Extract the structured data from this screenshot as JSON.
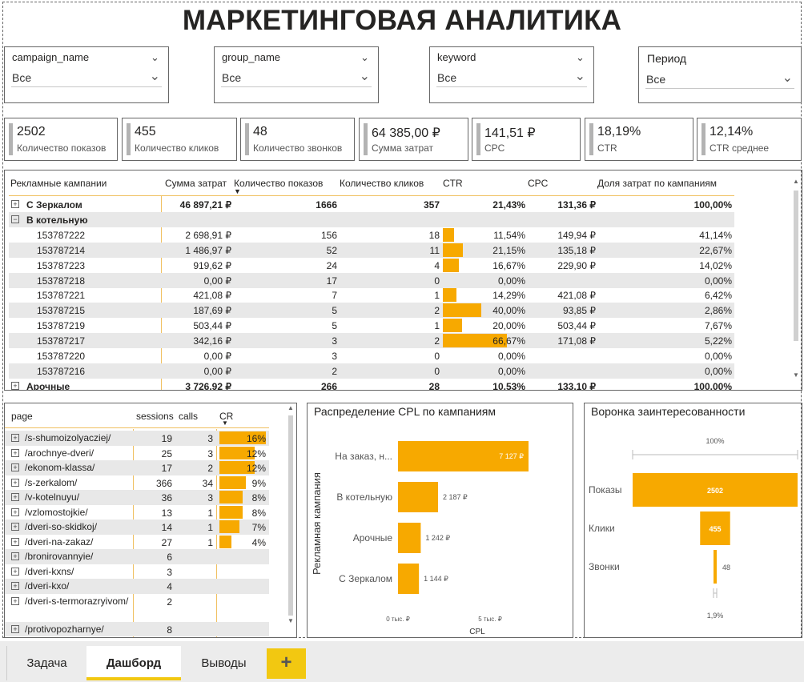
{
  "title": "МАРКЕТИНГОВАЯ АНАЛИТИКА",
  "slicers": [
    {
      "label": "campaign_name",
      "value": "Все"
    },
    {
      "label": "group_name",
      "value": "Все"
    },
    {
      "label": "keyword",
      "value": "Все"
    },
    {
      "label": "Период",
      "value": "Все"
    }
  ],
  "kpis": [
    {
      "value": "2502",
      "caption": "Количество показов"
    },
    {
      "value": "455",
      "caption": "Количество кликов"
    },
    {
      "value": "48",
      "caption": "Количество звонков"
    },
    {
      "value": "64 385,00 ₽",
      "caption": "Сумма затрат"
    },
    {
      "value": "141,51 ₽",
      "caption": "CPC"
    },
    {
      "value": "18,19%",
      "caption": "CTR"
    },
    {
      "value": "12,14%",
      "caption": "CTR среднее"
    }
  ],
  "matrix": {
    "headers": [
      "Рекламные кампании",
      "Сумма затрат",
      "Количество показов",
      "Количество кликов",
      "CTR",
      "CPC",
      "Доля затрат по кампаниям"
    ],
    "rows": [
      {
        "type": "group",
        "expand": "+",
        "name": "С Зеркалом",
        "cost": "46 897,21 ₽",
        "shows": "1666",
        "clicks": "357",
        "ctr": "21,43%",
        "ctr_value": 0,
        "cpc": "131,36 ₽",
        "share": "100,00%"
      },
      {
        "type": "group-open",
        "expand": "−",
        "name": "В котельную",
        "cost": "",
        "shows": "",
        "clicks": "",
        "ctr": "",
        "ctr_value": 0,
        "cpc": "",
        "share": ""
      },
      {
        "type": "item",
        "name": "153787222",
        "cost": "2 698,91 ₽",
        "shows": "156",
        "clicks": "18",
        "ctr": "11,54%",
        "ctr_value": 11.54,
        "cpc": "149,94 ₽",
        "share": "41,14%"
      },
      {
        "type": "item",
        "name": "153787214",
        "cost": "1 486,97 ₽",
        "shows": "52",
        "clicks": "11",
        "ctr": "21,15%",
        "ctr_value": 21.15,
        "cpc": "135,18 ₽",
        "share": "22,67%"
      },
      {
        "type": "item",
        "name": "153787223",
        "cost": "919,62 ₽",
        "shows": "24",
        "clicks": "4",
        "ctr": "16,67%",
        "ctr_value": 16.67,
        "cpc": "229,90 ₽",
        "share": "14,02%"
      },
      {
        "type": "item",
        "name": "153787218",
        "cost": "0,00 ₽",
        "shows": "17",
        "clicks": "0",
        "ctr": "0,00%",
        "ctr_value": 0,
        "cpc": "",
        "share": "0,00%"
      },
      {
        "type": "item",
        "name": "153787221",
        "cost": "421,08 ₽",
        "shows": "7",
        "clicks": "1",
        "ctr": "14,29%",
        "ctr_value": 14.29,
        "cpc": "421,08 ₽",
        "share": "6,42%"
      },
      {
        "type": "item",
        "name": "153787215",
        "cost": "187,69 ₽",
        "shows": "5",
        "clicks": "2",
        "ctr": "40,00%",
        "ctr_value": 40.0,
        "cpc": "93,85 ₽",
        "share": "2,86%"
      },
      {
        "type": "item",
        "name": "153787219",
        "cost": "503,44 ₽",
        "shows": "5",
        "clicks": "1",
        "ctr": "20,00%",
        "ctr_value": 20.0,
        "cpc": "503,44 ₽",
        "share": "7,67%"
      },
      {
        "type": "item",
        "name": "153787217",
        "cost": "342,16 ₽",
        "shows": "3",
        "clicks": "2",
        "ctr": "66,67%",
        "ctr_value": 66.67,
        "cpc": "171,08 ₽",
        "share": "5,22%"
      },
      {
        "type": "item",
        "name": "153787220",
        "cost": "0,00 ₽",
        "shows": "3",
        "clicks": "0",
        "ctr": "0,00%",
        "ctr_value": 0,
        "cpc": "",
        "share": "0,00%"
      },
      {
        "type": "item",
        "name": "153787216",
        "cost": "0,00 ₽",
        "shows": "2",
        "clicks": "0",
        "ctr": "0,00%",
        "ctr_value": 0,
        "cpc": "",
        "share": "0,00%"
      },
      {
        "type": "group",
        "expand": "+",
        "name": "Арочные",
        "cost": "3 726,92 ₽",
        "shows": "266",
        "clicks": "28",
        "ctr": "10,53%",
        "ctr_value": 0,
        "cpc": "133,10 ₽",
        "share": "100,00%"
      }
    ]
  },
  "pages_table": {
    "headers": [
      "page",
      "sessions",
      "calls",
      "CR"
    ],
    "rows": [
      {
        "page": "/s-shumoizolyacziej/",
        "sessions": "19",
        "calls": "3",
        "cr": "16%",
        "cr_value": 16
      },
      {
        "page": "/arochnye-dveri/",
        "sessions": "25",
        "calls": "3",
        "cr": "12%",
        "cr_value": 12
      },
      {
        "page": "/ekonom-klassa/",
        "sessions": "17",
        "calls": "2",
        "cr": "12%",
        "cr_value": 12
      },
      {
        "page": "/s-zerkalom/",
        "sessions": "366",
        "calls": "34",
        "cr": "9%",
        "cr_value": 9
      },
      {
        "page": "/v-kotelnuyu/",
        "sessions": "36",
        "calls": "3",
        "cr": "8%",
        "cr_value": 8
      },
      {
        "page": "/vzlomostojkie/",
        "sessions": "13",
        "calls": "1",
        "cr": "8%",
        "cr_value": 8
      },
      {
        "page": "/dveri-so-skidkoj/",
        "sessions": "14",
        "calls": "1",
        "cr": "7%",
        "cr_value": 7
      },
      {
        "page": "/dveri-na-zakaz/",
        "sessions": "27",
        "calls": "1",
        "cr": "4%",
        "cr_value": 4
      },
      {
        "page": "/bronirovannyie/",
        "sessions": "6",
        "calls": "",
        "cr": "",
        "cr_value": 0
      },
      {
        "page": "/dveri-kxns/",
        "sessions": "3",
        "calls": "",
        "cr": "",
        "cr_value": 0
      },
      {
        "page": "/dveri-kxo/",
        "sessions": "4",
        "calls": "",
        "cr": "",
        "cr_value": 0
      },
      {
        "page": "/dveri-s-termorazryivom/",
        "sessions": "2",
        "calls": "",
        "cr": "",
        "cr_value": 0
      },
      {
        "page": "/protivopozharnye/",
        "sessions": "8",
        "calls": "",
        "cr": "",
        "cr_value": 0
      }
    ]
  },
  "chart_data": [
    {
      "type": "bar",
      "orientation": "horizontal",
      "title": "Распределение CPL по кампаниям",
      "ylabel": "Рекламная кампания",
      "xlabel": "CPL",
      "categories": [
        "На заказ, н...",
        "В котельную",
        "Арочные",
        "С Зеркалом"
      ],
      "values": [
        7127,
        2187,
        1242,
        1144
      ],
      "value_labels": [
        "7 127 ₽",
        "2 187 ₽",
        "1 242 ₽",
        "1 144 ₽"
      ],
      "xticks": [
        "0 тыс. ₽",
        "5 тыс. ₽"
      ],
      "xlim": [
        0,
        7127
      ],
      "color": "#f7a900"
    },
    {
      "type": "bar",
      "orientation": "funnel",
      "title": "Воронка заинтересованности",
      "categories": [
        "Показы",
        "Клики",
        "Звонки"
      ],
      "values": [
        2502,
        455,
        48
      ],
      "value_labels": [
        "2502",
        "455",
        "48"
      ],
      "top_label": "100%",
      "bottom_label": "1,9%",
      "color": "#f7a900"
    }
  ],
  "tabs": [
    "Задача",
    "Дашборд",
    "Выводы"
  ],
  "add_tab": "+"
}
